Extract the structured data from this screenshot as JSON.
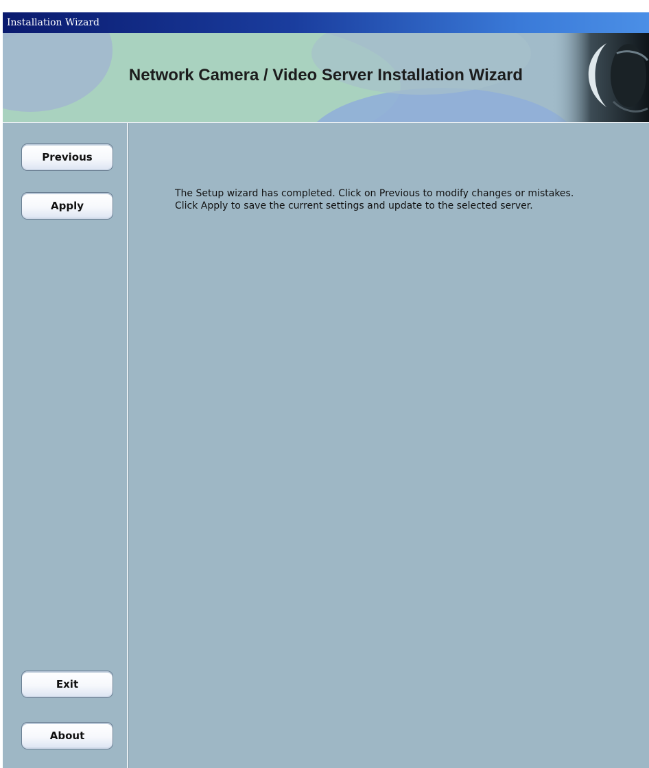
{
  "window": {
    "title": "Installation Wizard"
  },
  "banner": {
    "title": "Network Camera / Video Server Installation Wizard"
  },
  "sidebar": {
    "previous_label": "Previous",
    "apply_label": "Apply",
    "exit_label": "Exit",
    "about_label": "About"
  },
  "content": {
    "message_line1": "The Setup wizard has completed. Click on Previous to modify changes or mistakes.",
    "message_line2": "Click Apply to save the current settings and update to the selected server."
  },
  "colors": {
    "titlebar_start": "#0a1a6e",
    "titlebar_end": "#4b8fe6",
    "background": "#9eb7c5",
    "button_face": "#f6f8fc"
  },
  "icons": {
    "banner_image": "eye-icon"
  }
}
